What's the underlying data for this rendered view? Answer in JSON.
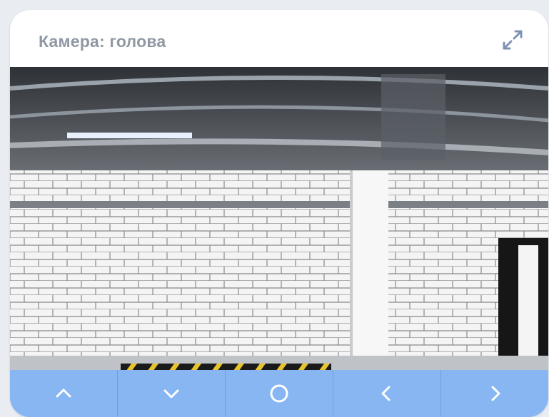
{
  "camera": {
    "title": "Камера: голова",
    "expand_icon": "expand-icon",
    "feed_description": "camera-view"
  },
  "controls": [
    {
      "icon": "chevron-up-icon"
    },
    {
      "icon": "chevron-down-icon"
    },
    {
      "icon": "circle-icon"
    },
    {
      "icon": "chevron-left-icon"
    },
    {
      "icon": "chevron-right-icon"
    }
  ],
  "colors": {
    "title": "#8f98a3",
    "control_bar": "#87b6f2",
    "control_divider": "#6e9fe0"
  }
}
